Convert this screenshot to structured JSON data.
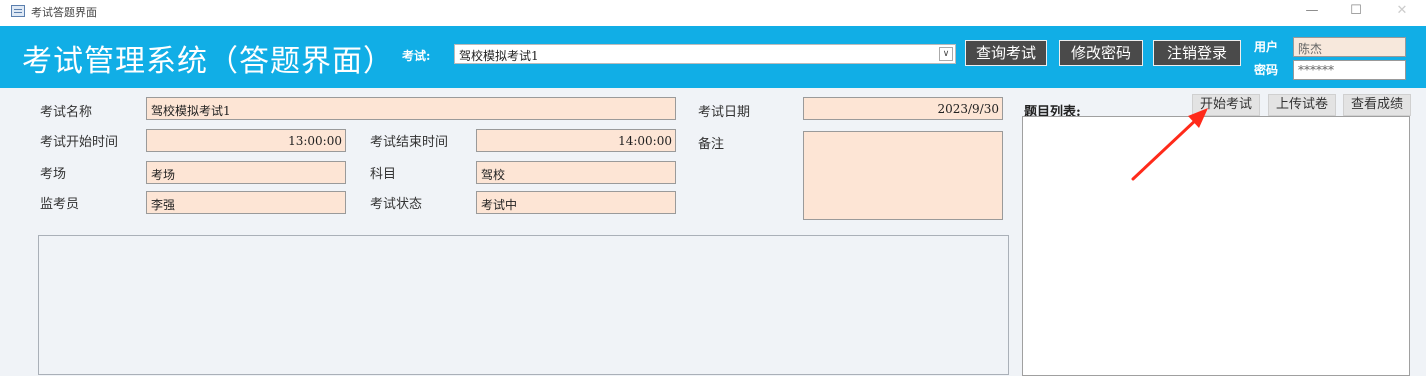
{
  "window": {
    "title": "考试答题界面"
  },
  "header": {
    "app_title": "考试管理系统（答题界面）",
    "exam_label": "考试:",
    "exam_selected": "驾校模拟考试1",
    "buttons": {
      "query": "查询考试",
      "change_pwd": "修改密码",
      "logout": "注销登录"
    },
    "user_label": "用户",
    "user_value": "陈杰",
    "password_label": "密码",
    "password_value": "******"
  },
  "form": {
    "exam_name_label": "考试名称",
    "exam_name": "驾校模拟考试1",
    "exam_date_label": "考试日期",
    "exam_date": "2023/9/30",
    "start_time_label": "考试开始时间",
    "start_time": "13:00:00",
    "end_time_label": "考试结束时间",
    "end_time": "14:00:00",
    "remark_label": "备注",
    "venue_label": "考场",
    "venue": "考场",
    "subject_label": "科目",
    "subject": "驾校",
    "proctor_label": "监考员",
    "proctor": "李强",
    "status_label": "考试状态",
    "status": "考试中"
  },
  "questions": {
    "list_label": "题目列表:",
    "buttons": {
      "start": "开始考试",
      "upload": "上传试卷",
      "view_score": "查看成绩"
    }
  },
  "colors": {
    "header": "#11aee6",
    "field_bg": "#fde5d5",
    "annotation_arrow": "#ff2a1a"
  }
}
